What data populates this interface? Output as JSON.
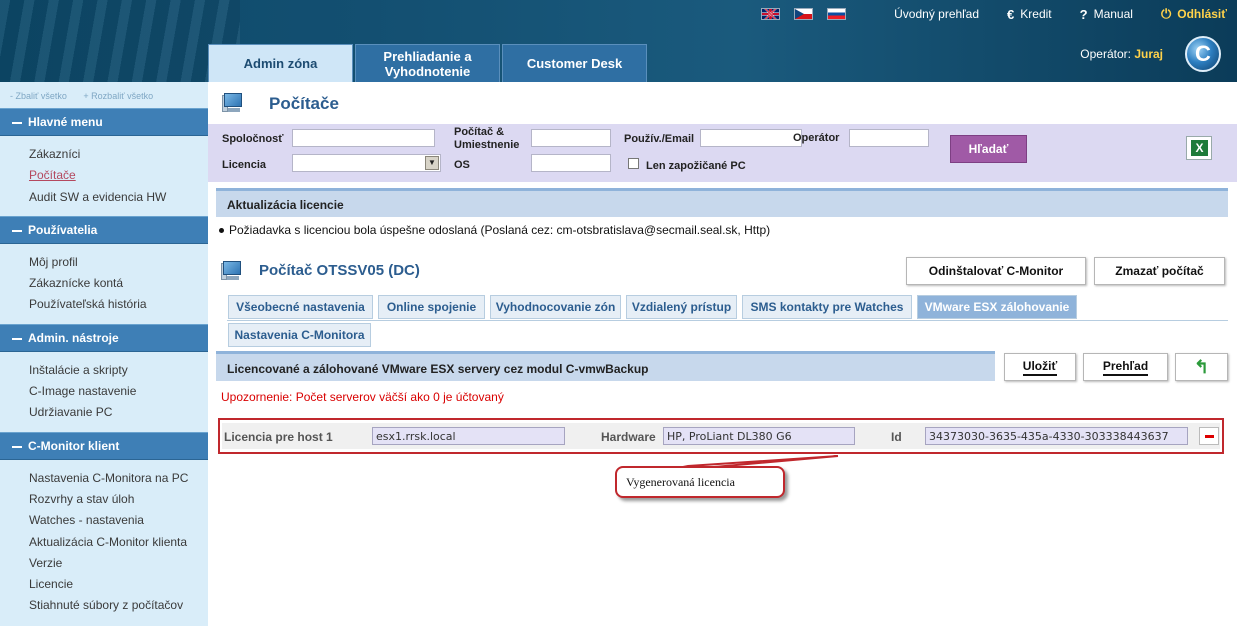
{
  "header": {
    "links": {
      "home": "Úvodný prehľad",
      "credit_icon": "€",
      "credit": "Kredit",
      "manual_icon": "?",
      "manual": "Manual",
      "logout_icon": "⏻",
      "logout": "Odhlásiť"
    },
    "operator_label": "Operátor:",
    "operator_name": "Juraj",
    "logo_letter": "C",
    "tabs": [
      "Admin zóna",
      "Prehliadanie a Vyhodnotenie",
      "Customer Desk"
    ]
  },
  "sidebar": {
    "collapse_all": "- Zbaliť všetko",
    "expand_all": "+ Rozbaliť všetko",
    "sections": [
      {
        "title": "Hlavné menu",
        "items": [
          "Zákazníci",
          "Počítače",
          "Audit SW a evidencia HW"
        ]
      },
      {
        "title": "Používatelia",
        "items": [
          "Môj profil",
          "Zákaznícke kontá",
          "Používateľská história"
        ]
      },
      {
        "title": "Admin. nástroje",
        "items": [
          "Inštalácie a skripty",
          "C-Image nastavenie",
          "Udržiavanie PC"
        ]
      },
      {
        "title": "C-Monitor klient",
        "items": [
          "Nastavenia C-Monitora na PC",
          "Rozvrhy a stav úloh",
          "Watches - nastavenia",
          "Aktualizácia C-Monitor klienta",
          "Verzie",
          "Licencie",
          "Stiahnuté súbory z počítačov"
        ]
      }
    ]
  },
  "page": {
    "title": "Počítače",
    "filter": {
      "company_label": "Spoločnosť",
      "computer_label": "Počítač & Umiestnenie",
      "user_label": "Použív./Email",
      "operator_label": "Operátor",
      "license_label": "Licencia",
      "os_label": "OS",
      "borrowed_label": "Len zapožičané PC",
      "search_button": "Hľadať",
      "excel_glyph": "X"
    },
    "license_update_bar": "Aktualizácia licencie",
    "message": "Požiadavka s licenciou bola úspešne odoslaná (Poslaná cez: cm-otsbratislava@secmail.seal.sk, Http)",
    "computer_title": "Počítač OTSSV05 (DC)",
    "uninstall_button": "Odinštalovať C-Monitor",
    "delete_button": "Zmazať počítač",
    "subtabs": [
      "Všeobecné nastavenia",
      "Online spojenie",
      "Vyhodnocovanie zón",
      "Vzdialený prístup",
      "SMS kontakty pre Watches",
      "VMware ESX zálohovanie",
      "Nastavenia C-Monitora"
    ],
    "section_bar": "Licencované a zálohované VMware ESX servery cez modul C-vmwBackup",
    "save_button": "Uložiť",
    "overview_button": "Prehľad",
    "back_icon": "↰",
    "warning": "Upozornenie: Počet serverov väčší ako 0 je účtovaný",
    "license_row": {
      "host_label": "Licencia pre host 1",
      "host_value": "esx1.rrsk.local",
      "hardware_label": "Hardware",
      "hardware_value": "HP, ProLiant DL380 G6",
      "id_label": "Id",
      "id_value": "34373030-3635-435a-4330-303338443637"
    },
    "callout": "Vygenerovaná licencia"
  }
}
